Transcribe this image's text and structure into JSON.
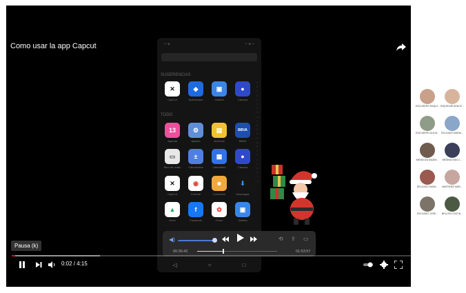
{
  "video": {
    "title": "Como usar la app Capcut",
    "tooltip": "Pausa (k)",
    "time_display": "0:02 / 4:15",
    "played_fraction": 0.008,
    "accent_color": "#e1002d",
    "icons": [
      "share-icon",
      "pause-icon",
      "next-icon",
      "volume-icon",
      "autoplay-toggle-icon",
      "settings-icon",
      "fullscreen-icon"
    ]
  },
  "phone": {
    "section_suggestions": "SUGERENCIAS",
    "section_all": "TODO",
    "apps": [
      {
        "label": "CapCut",
        "glyph": "✕",
        "color": "#ffffff",
        "fg": "#111111"
      },
      {
        "label": "Optimizador",
        "glyph": "◆",
        "color": "#1e6be0",
        "fg": "#ffffff"
      },
      {
        "label": "Galería",
        "glyph": "▣",
        "color": "#3a86e8",
        "fg": "#ffffff"
      },
      {
        "label": "Cámara",
        "glyph": "●",
        "color": "#2f49c9",
        "fg": "#ffffff"
      },
      {
        "label": "Agenda",
        "glyph": "13",
        "color": "#ef4f9c",
        "fg": "#ffffff"
      },
      {
        "label": "Ajustes",
        "glyph": "⚙",
        "color": "#5f8fd6",
        "fg": "#ffffff"
      },
      {
        "label": "Archivos",
        "glyph": "▤",
        "color": "#f1c232",
        "fg": "#ffffff"
      },
      {
        "label": "BBVA",
        "glyph": "BBVA",
        "color": "#1c4fb0",
        "fg": "#ffffff"
      },
      {
        "label": "Bloc de notas",
        "glyph": "▭",
        "color": "#e8e8e8",
        "fg": "#555555"
      },
      {
        "label": "Calculadora",
        "glyph": "±",
        "color": "#4f7fe0",
        "fg": "#ffffff"
      },
      {
        "label": "Calendario",
        "glyph": "▦",
        "color": "#2f73e6",
        "fg": "#ffffff"
      },
      {
        "label": "Cámara",
        "glyph": "●",
        "color": "#2f49c9",
        "fg": "#ffffff"
      },
      {
        "label": "CapCut",
        "glyph": "✕",
        "color": "#ffffff",
        "fg": "#111111"
      },
      {
        "label": "Chrome",
        "glyph": "◉",
        "color": "#ffffff",
        "fg": "#db4437"
      },
      {
        "label": "Contactos",
        "glyph": "☻",
        "color": "#f2a93b",
        "fg": "#ffffff"
      },
      {
        "label": "Descargas",
        "glyph": "⬇",
        "color": "#151515",
        "fg": "#2f8fe8"
      },
      {
        "label": "Drive",
        "glyph": "▲",
        "color": "#ffffff",
        "fg": "#1fa463"
      },
      {
        "label": "Facebook",
        "glyph": "f",
        "color": "#1877f2",
        "fg": "#ffffff"
      },
      {
        "label": "Fotos",
        "glyph": "✿",
        "color": "#ffffff",
        "fg": "#ea4335"
      },
      {
        "label": "Galería",
        "glyph": "▣",
        "color": "#3a86e8",
        "fg": "#ffffff"
      }
    ],
    "alphabet": "A B C D E F G H I J K L M N O P Q R S T U V W X Y Z #"
  },
  "media_popup": {
    "elapsed": "00:36:42",
    "duration": "01:53:57",
    "progress_fraction": 0.32,
    "volume_fraction": 0.78
  },
  "participants": [
    {
      "name": "ESCUDERO RAQUI...",
      "color": "#c9a08a"
    },
    {
      "name": "RIQUELME ARACE...",
      "color": "#d7b59c"
    },
    {
      "name": "ESCUDERO ALEJA...",
      "color": "#8f9c88"
    },
    {
      "name": "DELGADO MARIA...",
      "color": "#8aa6c8"
    },
    {
      "name": "MENDOZA MAZIM...",
      "color": "#6f5c4e"
    },
    {
      "name": "MEDINA IVAN C...",
      "color": "#3b3f5a"
    },
    {
      "name": "DELGADO SARA...",
      "color": "#9a5a4f"
    },
    {
      "name": "MARTINEZ MAR...",
      "color": "#c7a6a0"
    },
    {
      "name": "DELGADO JOSE...",
      "color": "#7c7468"
    },
    {
      "name": "BELLIDO CINTIA...",
      "color": "#4c5a44"
    }
  ]
}
